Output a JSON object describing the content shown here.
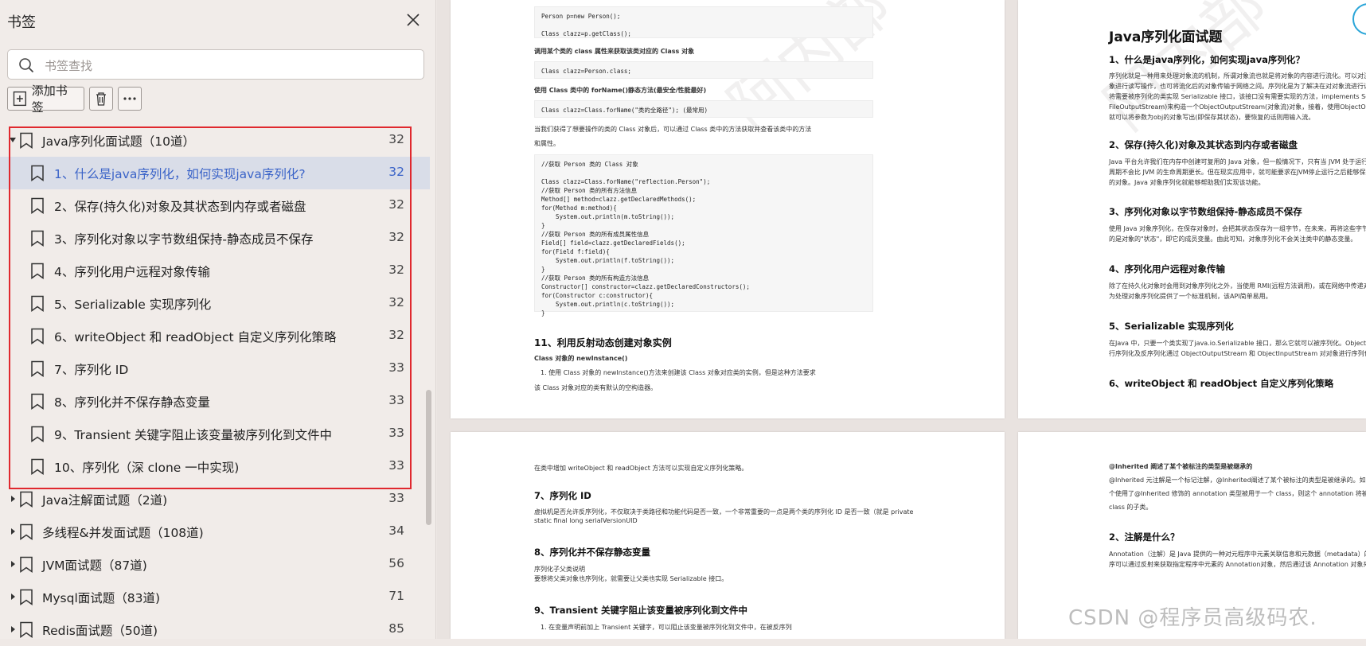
{
  "sidebar": {
    "title": "书签",
    "search_placeholder": "书签查找",
    "add_bookmark_label": "添加书签",
    "items": [
      {
        "label": "Java序列化面试题（10道）",
        "page": "32"
      },
      {
        "label": "1、什么是java序列化，如何实现java序列化?",
        "page": "32"
      },
      {
        "label": "2、保存(持久化)对象及其状态到内存或者磁盘",
        "page": "32"
      },
      {
        "label": "3、序列化对象以字节数组保持-静态成员不保存",
        "page": "32"
      },
      {
        "label": "4、序列化用户远程对象传输",
        "page": "32"
      },
      {
        "label": "5、Serializable 实现序列化",
        "page": "32"
      },
      {
        "label": "6、writeObject 和 readObject 自定义序列化策略",
        "page": "32"
      },
      {
        "label": "7、序列化 ID",
        "page": "33"
      },
      {
        "label": "8、序列化并不保存静态变量",
        "page": "33"
      },
      {
        "label": "9、Transient 关键字阻止该变量被序列化到文件中",
        "page": "33"
      },
      {
        "label": "10、序列化（深 clone 一中实现)",
        "page": "33"
      },
      {
        "label": "Java注解面试题（2道)",
        "page": "33"
      },
      {
        "label": "多线程&并发面试题（108道)",
        "page": "34"
      },
      {
        "label": "JVM面试题（87道)",
        "page": "56"
      },
      {
        "label": "Mysql面试题（83道)",
        "page": "71"
      },
      {
        "label": "Redis面试题（50道)",
        "page": "85"
      }
    ]
  },
  "page1": {
    "code1": "Person p=new Person();\n\nClass clazz=p.getClass();",
    "t1": "调用某个类的 class 属性来获取该类对应的 Class 对象",
    "code2": "Class clazz=Person.class;",
    "t2": "使用 Class 类中的 forName()静态方法(最安全/性能最好)",
    "code3": "Class clazz=Class.forName(\"类的全路径\"); (最常用)",
    "t3": "当我们获得了想要操作的类的 Class 对象后，可以通过 Class 类中的方法获取并查看该类中的方法",
    "t4": "和属性。",
    "code4": "//获取 Person 类的 Class 对象\n\nClass clazz=Class.forName(\"reflection.Person\");\n//获取 Person 类的所有方法信息\nMethod[] method=clazz.getDeclaredMethods();\nfor(Method m:method){\n    System.out.println(m.toString());\n}\n//获取 Person 类的所有成员属性信息\nField[] field=clazz.getDeclaredFields();\nfor(Field f:field){\n    System.out.println(f.toString());\n}\n//获取 Person 类的所有构造方法信息\nConstructor[] constructor=clazz.getDeclaredConstructors();\nfor(Constructor c:constructor){\n    System.out.println(c.toString());\n}",
    "h1": "11、利用反射动态创建对象实例",
    "t5": "Class 对象的 newInstance()",
    "t6": "1. 使用 Class 对象的 newInstance()方法来创建该 Class 对象对应类的实例，但是这种方法要求",
    "t7": "该 Class 对象对应的类有默认的空构造器。"
  },
  "page2": {
    "title": "Java序列化面试题",
    "h1": "1、什么是java序列化，如何实现java序列化？",
    "p1a": "序列化就是一种用来处理对象流的机制，所谓对象流也就是将对象的内容进行流化。可以对流化后的对",
    "p1b": "象进行读写操作，也可将流化后的对象传输于网络之间。序列化是为了解决在对对象流进行读写操作时所引发的问题。序列化的实现：",
    "p1c": "将需要被序列化的类实现 Serializable 接口，该接口没有需要实现的方法，implements Serializable 只是为了标注该对象是可被序列化的，",
    "p1d": "FileOutputStream)来构造一个ObjectOutputStream(对象流)对象，接着，使用ObjectOutputStream",
    "p1e": "就可以将参数为obj的对象写出(即保存其状态)，要恢复的话则用输入流。",
    "h2": "2、保存(持久化)对象及其状态到内存或者磁盘",
    "p2a": "Java 平台允许我们在内存中创建可复用的 Java 对象，但一般情况下，只有当 JVM 处于运行时，这些对象",
    "p2b": "周期不会比 JVM 的生命周期更长。但在现实应用中，就可能要求在JVM停止运行之后能够保存(持久化)指",
    "p2c": "的对象。Java 对象序列化就能够帮助我们实现该功能。",
    "h3": "3、序列化对象以字节数组保持-静态成员不保存",
    "p3a": "使用 Java 对象序列化，在保存对象时，会把其状态保存为一组字节，在未来，再将这些字节组装成对象。",
    "p3b": "的是对象的\"状态\"，即它的成员变量。由此可知，对象序列化不会关注类中的静态变量。",
    "h4": "4、序列化用户远程对象传输",
    "p4a": "除了在持久化对象时会用到对象序列化之外，当使用 RMI(远程方法调用)，或在网络中传递对象时，都会",
    "p4b": "为处理对象序列化提供了一个标准机制，该API简单易用。",
    "h5": "5、Serializable 实现序列化",
    "p5a": "在Java 中，只要一个类实现了java.io.Serializable 接口，那么它就可以被序列化。ObjectOutputStream",
    "p5b": "行序列化及反序列化通过 ObjectOutputStream 和 ObjectInputStream 对对象进行序列化及反序列化。",
    "h6": "6、writeObject 和 readObject 自定义序列化策略"
  },
  "page3": {
    "t1": "在类中增加 writeObject 和 readObject 方法可以实现自定义序列化策略。",
    "h1": "7、序列化 ID",
    "t2": "虚拟机是否允许反序列化，不仅取决于类路径和功能代码是否一致，一个非常重要的一点是两个类的序列化 ID 是否一致（就是 private",
    "t3": "static final long serialVersionUID",
    "h2": "8、序列化并不保存静态变量",
    "t4": "序列化子父类说明",
    "t5": "要想将父类对象也序列化，就需要让父类也实现 Serializable 接口。",
    "h3": "9、Transient 关键字阻止该变量被序列化到文件中",
    "t6": "1. 在变量声明前加上 Transient 关键字，可以阻止该变量被序列化到文件中，在被反序列"
  },
  "page4": {
    "t1": "@Inherited 阐述了某个被标注的类型是被继承的",
    "t2": "@Inherited 元注解是一个标记注解，@Inherited阐述了某个被标注的类型是被继承的。如果一",
    "t3": "个使用了@Inherited 修饰的 annotation 类型被用于一个 class，则这个 annotation 将被用于该",
    "t4": "class 的子类。",
    "h1": "2、注解是什么？",
    "t5": "Annotation（注解）是 Java 提供的一种对元程序中元素关联信息和元数据（metadata）的途径和方法",
    "t6": "序可以通过反射来获取指定程序中元素的 Annotation对象，然后通过该 Annotation 对象来获取注解"
  },
  "watermark": "CSDN @程序员高级码农."
}
